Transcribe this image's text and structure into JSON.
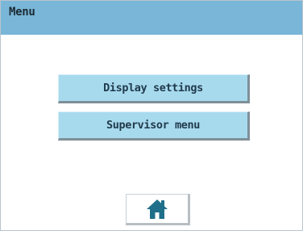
{
  "header": {
    "title": "Menu"
  },
  "menu": {
    "items": [
      {
        "label": "Display settings"
      },
      {
        "label": "Supervisor menu"
      }
    ]
  },
  "footer": {
    "home_icon": "home-icon"
  },
  "colors": {
    "titlebar": "#79b6d8",
    "button": "#a8daee",
    "icon": "#1f6f8a"
  }
}
